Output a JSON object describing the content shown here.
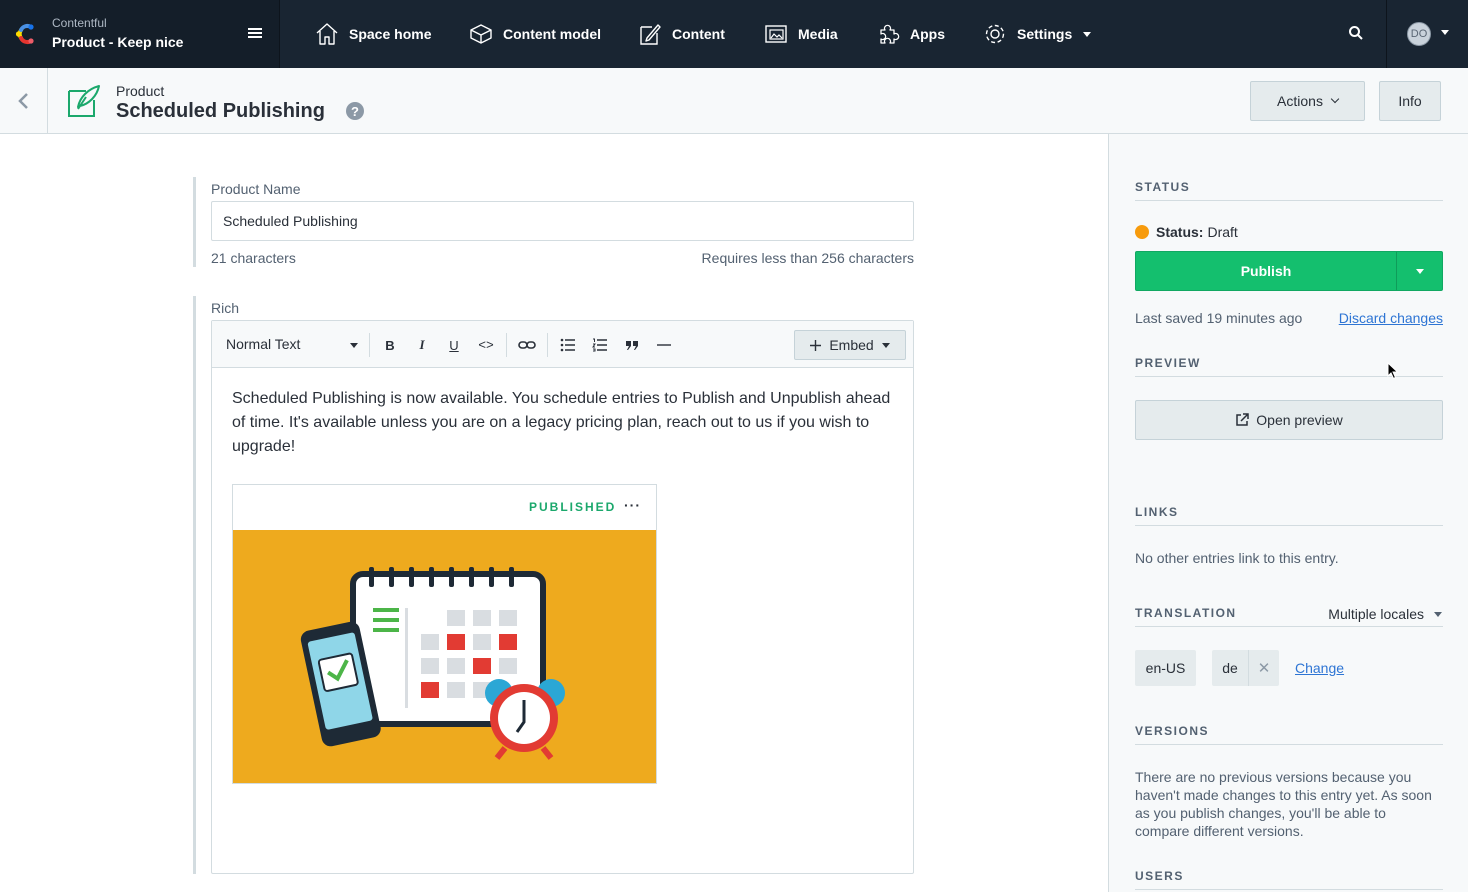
{
  "app": {
    "org_name": "Contentful",
    "space_name": "Product - Keep nice",
    "avatar_initials": "DO"
  },
  "nav": {
    "items": [
      {
        "label": "Space home",
        "icon": "home-icon"
      },
      {
        "label": "Content model",
        "icon": "content-model-icon"
      },
      {
        "label": "Content",
        "icon": "content-icon"
      },
      {
        "label": "Media",
        "icon": "media-icon"
      },
      {
        "label": "Apps",
        "icon": "apps-icon"
      },
      {
        "label": "Settings",
        "icon": "settings-icon"
      }
    ]
  },
  "entry_header": {
    "content_type": "Product",
    "title": "Scheduled Publishing",
    "help_glyph": "?",
    "actions_label": "Actions",
    "info_label": "Info"
  },
  "fields": {
    "product_name": {
      "label": "Product Name",
      "value": "Scheduled Publishing",
      "char_count": "21 characters",
      "limit": "Requires less than 256 characters"
    },
    "rich": {
      "label": "Rich",
      "toolbar": {
        "heading": "Normal Text",
        "bold": "B",
        "italic": "I",
        "underline": "U",
        "code": "<>",
        "embed_label": "Embed"
      },
      "paragraph": "Scheduled Publishing is now available. You schedule entries to Publish and Unpublish ahead of time. It's available unless you are on a legacy pricing plan, reach out to us if you wish to upgrade!",
      "embedded": {
        "status": "PUBLISHED",
        "menu": "···",
        "image_icon": "calendar-alarm-illustration"
      }
    }
  },
  "sidebar": {
    "status": {
      "heading": "STATUS",
      "prefix": "Status:",
      "value": "Draft",
      "publish_label": "Publish",
      "last_saved": "Last saved 19 minutes ago",
      "discard_label": "Discard changes"
    },
    "preview": {
      "heading": "PREVIEW",
      "button_label": "Open preview"
    },
    "links": {
      "heading": "LINKS",
      "text": "No other entries link to this entry."
    },
    "translation": {
      "heading": "TRANSLATION",
      "mode": "Multiple locales",
      "locales": [
        "en-US",
        "de"
      ],
      "remove_glyph": "✕",
      "change_label": "Change"
    },
    "versions": {
      "heading": "VERSIONS",
      "text": "There are no previous versions because you haven't made changes to this entry yet. As soon as you publish changes, you'll be able to compare different versions."
    },
    "users": {
      "heading": "USERS"
    }
  },
  "colors": {
    "nav_bg": "#192532",
    "publish_green": "#14bf6e",
    "draft_orange": "#f79b0c",
    "published_text": "#1ba86c",
    "link_blue": "#2e75d4",
    "embed_image_bg": "#eeaa1e"
  }
}
